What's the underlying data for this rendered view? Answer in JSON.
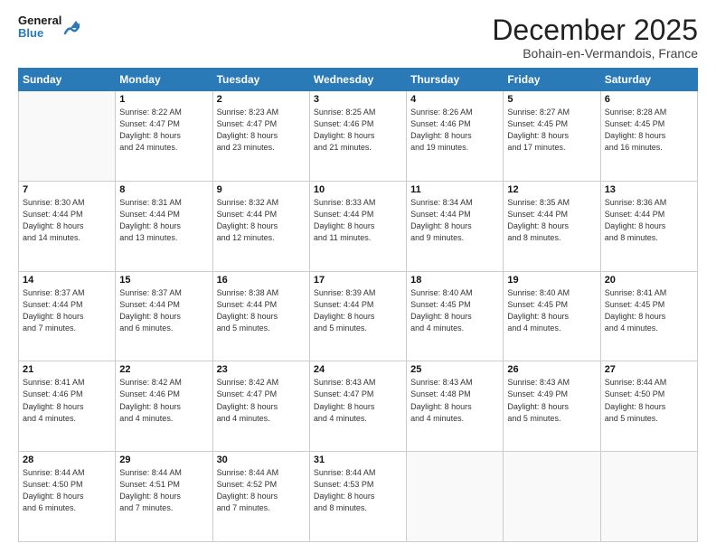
{
  "header": {
    "logo_line1": "General",
    "logo_line2": "Blue",
    "month": "December 2025",
    "location": "Bohain-en-Vermandois, France"
  },
  "weekdays": [
    "Sunday",
    "Monday",
    "Tuesday",
    "Wednesday",
    "Thursday",
    "Friday",
    "Saturday"
  ],
  "weeks": [
    [
      {
        "day": "",
        "info": ""
      },
      {
        "day": "1",
        "info": "Sunrise: 8:22 AM\nSunset: 4:47 PM\nDaylight: 8 hours\nand 24 minutes."
      },
      {
        "day": "2",
        "info": "Sunrise: 8:23 AM\nSunset: 4:47 PM\nDaylight: 8 hours\nand 23 minutes."
      },
      {
        "day": "3",
        "info": "Sunrise: 8:25 AM\nSunset: 4:46 PM\nDaylight: 8 hours\nand 21 minutes."
      },
      {
        "day": "4",
        "info": "Sunrise: 8:26 AM\nSunset: 4:46 PM\nDaylight: 8 hours\nand 19 minutes."
      },
      {
        "day": "5",
        "info": "Sunrise: 8:27 AM\nSunset: 4:45 PM\nDaylight: 8 hours\nand 17 minutes."
      },
      {
        "day": "6",
        "info": "Sunrise: 8:28 AM\nSunset: 4:45 PM\nDaylight: 8 hours\nand 16 minutes."
      }
    ],
    [
      {
        "day": "7",
        "info": "Sunrise: 8:30 AM\nSunset: 4:44 PM\nDaylight: 8 hours\nand 14 minutes."
      },
      {
        "day": "8",
        "info": "Sunrise: 8:31 AM\nSunset: 4:44 PM\nDaylight: 8 hours\nand 13 minutes."
      },
      {
        "day": "9",
        "info": "Sunrise: 8:32 AM\nSunset: 4:44 PM\nDaylight: 8 hours\nand 12 minutes."
      },
      {
        "day": "10",
        "info": "Sunrise: 8:33 AM\nSunset: 4:44 PM\nDaylight: 8 hours\nand 11 minutes."
      },
      {
        "day": "11",
        "info": "Sunrise: 8:34 AM\nSunset: 4:44 PM\nDaylight: 8 hours\nand 9 minutes."
      },
      {
        "day": "12",
        "info": "Sunrise: 8:35 AM\nSunset: 4:44 PM\nDaylight: 8 hours\nand 8 minutes."
      },
      {
        "day": "13",
        "info": "Sunrise: 8:36 AM\nSunset: 4:44 PM\nDaylight: 8 hours\nand 8 minutes."
      }
    ],
    [
      {
        "day": "14",
        "info": "Sunrise: 8:37 AM\nSunset: 4:44 PM\nDaylight: 8 hours\nand 7 minutes."
      },
      {
        "day": "15",
        "info": "Sunrise: 8:37 AM\nSunset: 4:44 PM\nDaylight: 8 hours\nand 6 minutes."
      },
      {
        "day": "16",
        "info": "Sunrise: 8:38 AM\nSunset: 4:44 PM\nDaylight: 8 hours\nand 5 minutes."
      },
      {
        "day": "17",
        "info": "Sunrise: 8:39 AM\nSunset: 4:44 PM\nDaylight: 8 hours\nand 5 minutes."
      },
      {
        "day": "18",
        "info": "Sunrise: 8:40 AM\nSunset: 4:45 PM\nDaylight: 8 hours\nand 4 minutes."
      },
      {
        "day": "19",
        "info": "Sunrise: 8:40 AM\nSunset: 4:45 PM\nDaylight: 8 hours\nand 4 minutes."
      },
      {
        "day": "20",
        "info": "Sunrise: 8:41 AM\nSunset: 4:45 PM\nDaylight: 8 hours\nand 4 minutes."
      }
    ],
    [
      {
        "day": "21",
        "info": "Sunrise: 8:41 AM\nSunset: 4:46 PM\nDaylight: 8 hours\nand 4 minutes."
      },
      {
        "day": "22",
        "info": "Sunrise: 8:42 AM\nSunset: 4:46 PM\nDaylight: 8 hours\nand 4 minutes."
      },
      {
        "day": "23",
        "info": "Sunrise: 8:42 AM\nSunset: 4:47 PM\nDaylight: 8 hours\nand 4 minutes."
      },
      {
        "day": "24",
        "info": "Sunrise: 8:43 AM\nSunset: 4:47 PM\nDaylight: 8 hours\nand 4 minutes."
      },
      {
        "day": "25",
        "info": "Sunrise: 8:43 AM\nSunset: 4:48 PM\nDaylight: 8 hours\nand 4 minutes."
      },
      {
        "day": "26",
        "info": "Sunrise: 8:43 AM\nSunset: 4:49 PM\nDaylight: 8 hours\nand 5 minutes."
      },
      {
        "day": "27",
        "info": "Sunrise: 8:44 AM\nSunset: 4:50 PM\nDaylight: 8 hours\nand 5 minutes."
      }
    ],
    [
      {
        "day": "28",
        "info": "Sunrise: 8:44 AM\nSunset: 4:50 PM\nDaylight: 8 hours\nand 6 minutes."
      },
      {
        "day": "29",
        "info": "Sunrise: 8:44 AM\nSunset: 4:51 PM\nDaylight: 8 hours\nand 7 minutes."
      },
      {
        "day": "30",
        "info": "Sunrise: 8:44 AM\nSunset: 4:52 PM\nDaylight: 8 hours\nand 7 minutes."
      },
      {
        "day": "31",
        "info": "Sunrise: 8:44 AM\nSunset: 4:53 PM\nDaylight: 8 hours\nand 8 minutes."
      },
      {
        "day": "",
        "info": ""
      },
      {
        "day": "",
        "info": ""
      },
      {
        "day": "",
        "info": ""
      }
    ]
  ]
}
